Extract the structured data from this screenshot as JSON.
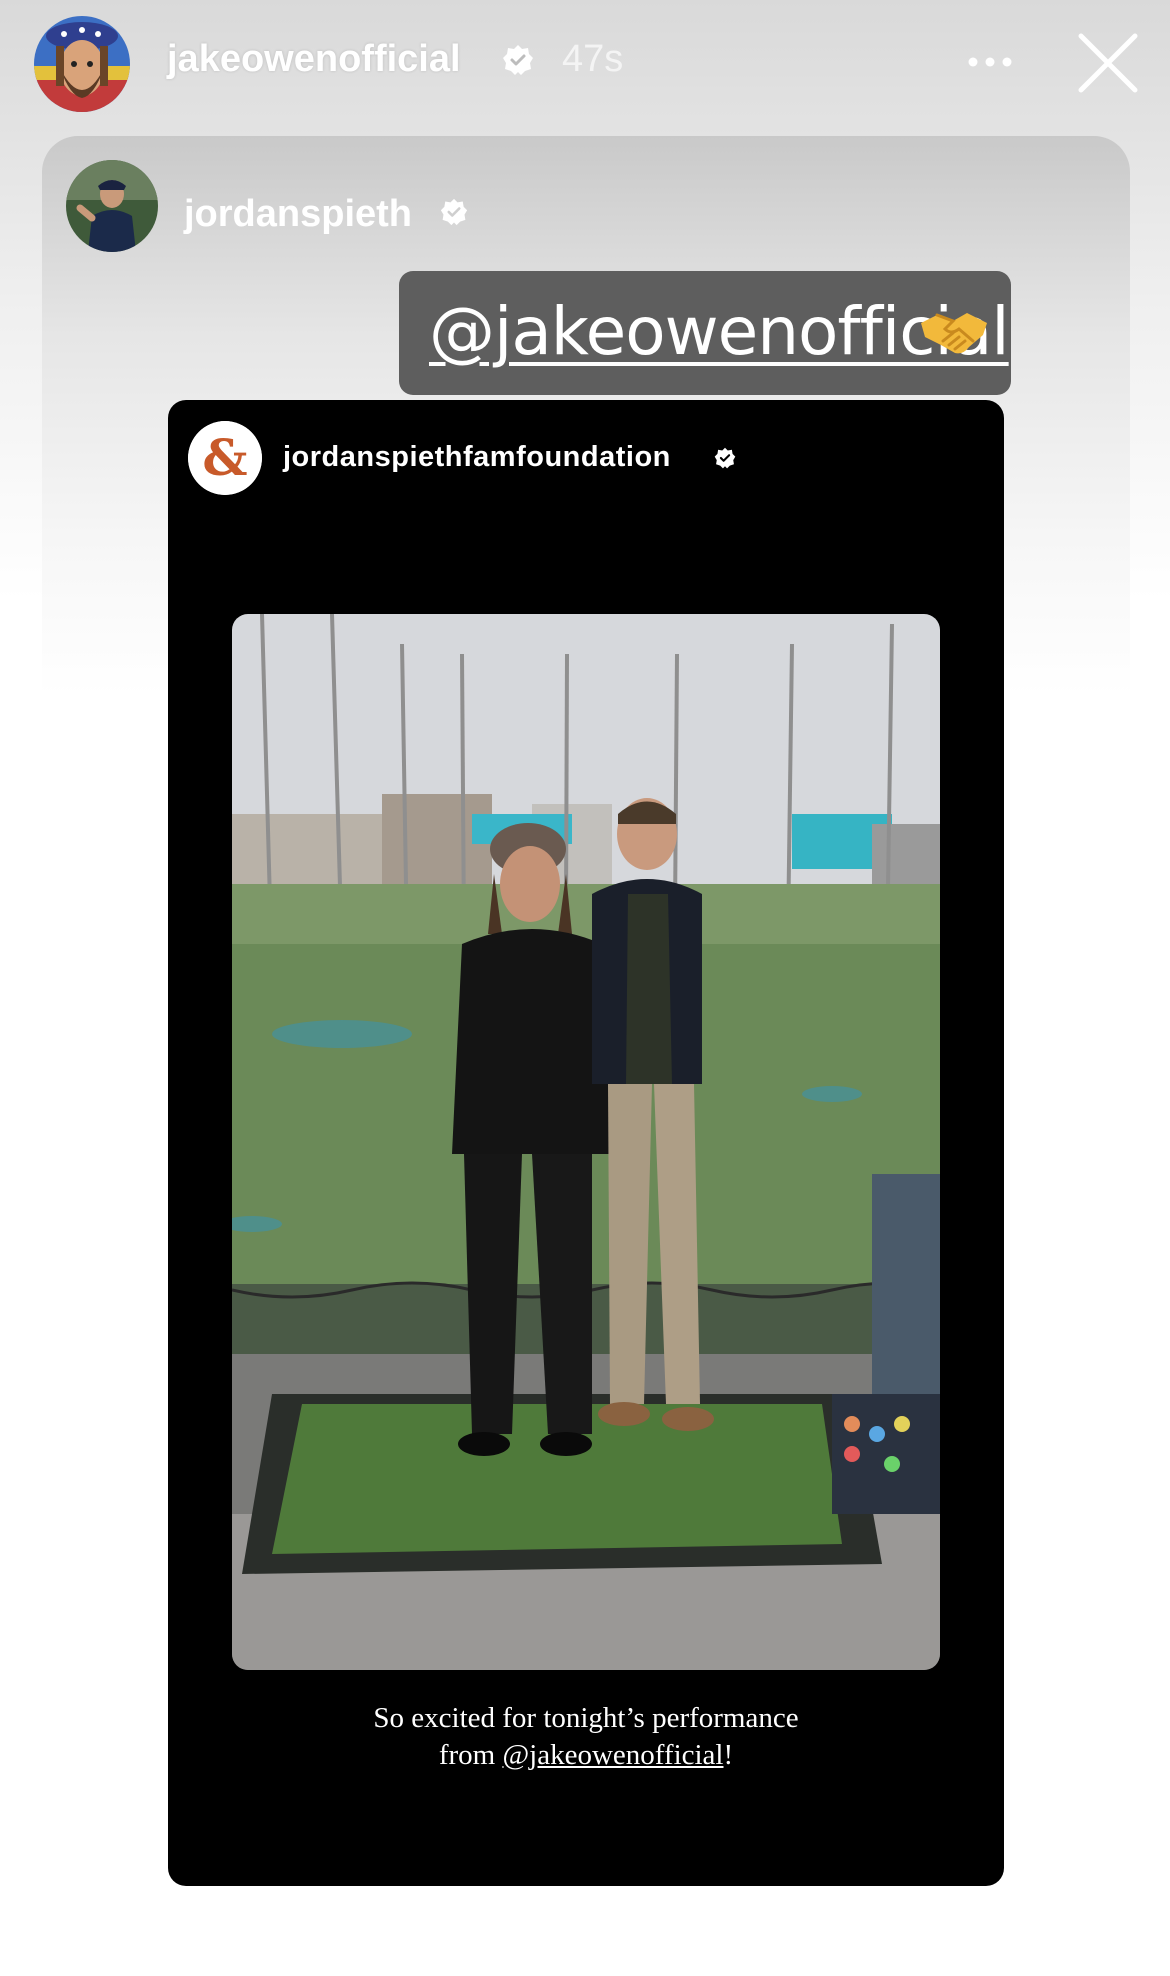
{
  "story": {
    "username": "jakeowenofficial",
    "time": "47s"
  },
  "reshare": {
    "username": "jordanspieth",
    "mention": "@jakeowenofficial"
  },
  "post": {
    "account": "jordanspiethfamfoundation",
    "caption_line1": "So excited for tonight’s performance",
    "caption_prefix": "from ",
    "caption_handle": "@jakeowenofficial",
    "caption_suffix": "!"
  },
  "colors": {
    "sticker_bg": "#5e5e5e",
    "brand_orange": "#c85a2a",
    "turf": "#5f8a45"
  }
}
